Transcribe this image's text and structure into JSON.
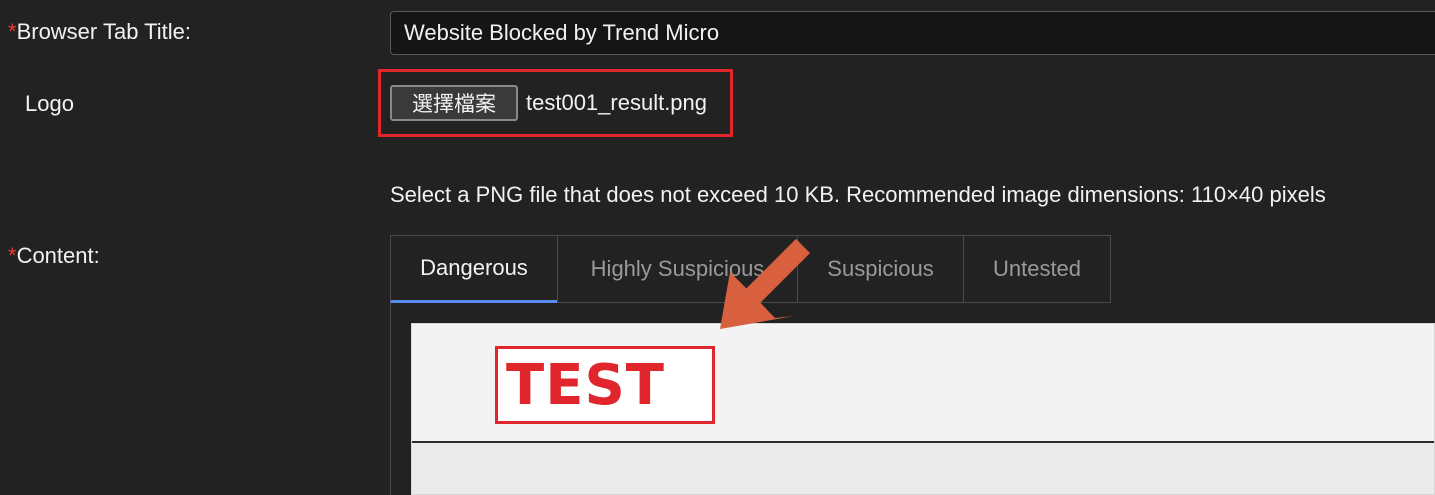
{
  "form": {
    "browser_tab_title": {
      "required_mark": "*",
      "label": "Browser Tab Title:",
      "value": "Website Blocked by Trend Micro"
    },
    "logo": {
      "label": "Logo",
      "choose_file_label": "選擇檔案",
      "file_name": "test001_result.png",
      "hint": "Select a PNG file that does not exceed 10 KB. Recommended image dimensions: 110×40 pixels",
      "preview_text": "TEST"
    },
    "content": {
      "required_mark": "*",
      "label": "Content:",
      "tabs": [
        {
          "label": "Dangerous",
          "active": true
        },
        {
          "label": "Highly Suspicious",
          "active": false
        },
        {
          "label": "Suspicious",
          "active": false
        },
        {
          "label": "Untested",
          "active": false
        }
      ]
    }
  },
  "annotation": {
    "highlight_color": "#e0262c",
    "arrow_color": "#d9603f",
    "arrow_icon": "arrow-down-left-icon"
  }
}
